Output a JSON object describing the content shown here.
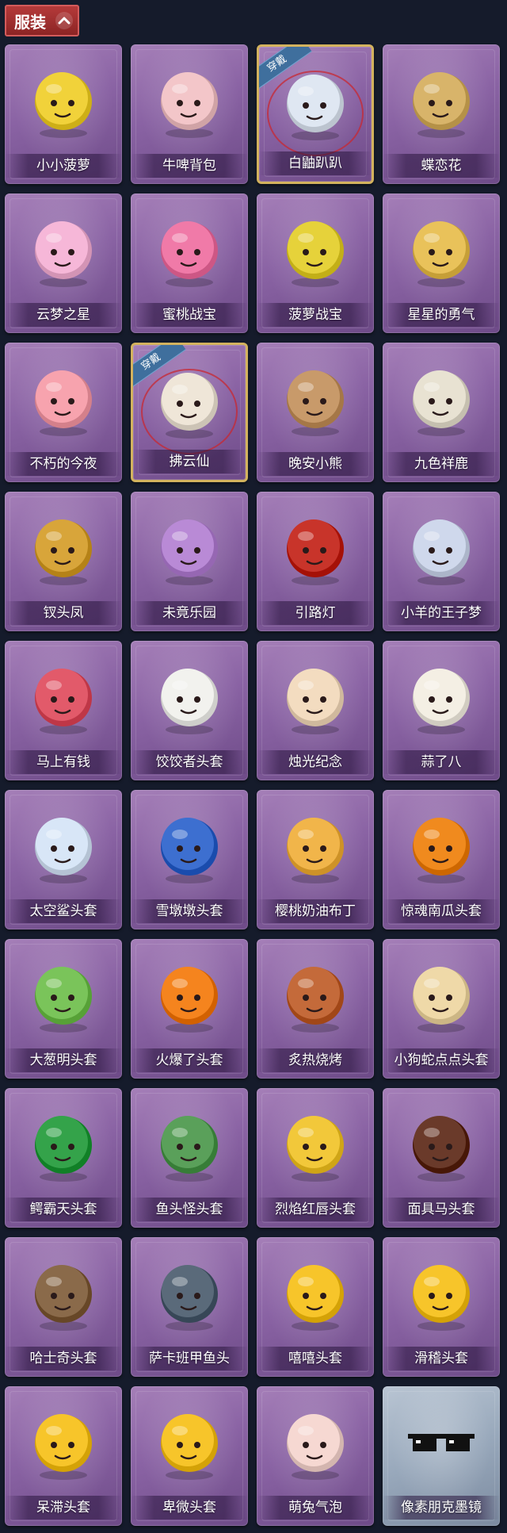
{
  "section": {
    "label": "服装"
  },
  "equipped_badge": "穿戴",
  "items": [
    {
      "name": "小小菠萝",
      "color": "#f1d23a",
      "icon": "pineapple-costume-icon"
    },
    {
      "name": "牛啤背包",
      "color": "#f3c6c9",
      "icon": "cow-beer-backpack-icon"
    },
    {
      "name": "白鼬趴趴",
      "color": "#dfe7f2",
      "icon": "white-weasel-icon",
      "equipped": true
    },
    {
      "name": "蝶恋花",
      "color": "#d8b46a",
      "icon": "butterfly-charm-icon"
    },
    {
      "name": "云梦之星",
      "color": "#f6b7d8",
      "icon": "unicorn-cloud-icon"
    },
    {
      "name": "蜜桃战宝",
      "color": "#f07aa8",
      "icon": "peach-robot-charm-icon"
    },
    {
      "name": "菠萝战宝",
      "color": "#e6d23a",
      "icon": "pineapple-robot-charm-icon"
    },
    {
      "name": "星星的勇气",
      "color": "#e9c25a",
      "icon": "star-courage-charm-icon"
    },
    {
      "name": "不朽的今夜",
      "color": "#f7a3ae",
      "icon": "fox-dessert-icon"
    },
    {
      "name": "拂云仙",
      "color": "#efe6d8",
      "icon": "cloud-fairy-charm-icon",
      "equipped": true
    },
    {
      "name": "晚安小熊",
      "color": "#c89a6a",
      "icon": "goodnight-bear-charm-icon"
    },
    {
      "name": "九色祥鹿",
      "color": "#e8e2d2",
      "icon": "nine-color-deer-icon"
    },
    {
      "name": "钗头凤",
      "color": "#d8a53a",
      "icon": "phoenix-hairpin-icon"
    },
    {
      "name": "未竟乐园",
      "color": "#b98ad6",
      "icon": "paradise-girl-charm-icon"
    },
    {
      "name": "引路灯",
      "color": "#c8342a",
      "icon": "lantern-icon"
    },
    {
      "name": "小羊的王子梦",
      "color": "#cfd8ec",
      "icon": "sheep-prince-icon"
    },
    {
      "name": "马上有钱",
      "color": "#e25a6a",
      "icon": "horse-head-icon"
    },
    {
      "name": "饺饺者头套",
      "color": "#f2f2ee",
      "icon": "dumpling-head-icon"
    },
    {
      "name": "烛光纪念",
      "color": "#f3dcc0",
      "icon": "candle-head-icon"
    },
    {
      "name": "蒜了八",
      "color": "#f4efe4",
      "icon": "garlic-head-icon"
    },
    {
      "name": "太空鲨头套",
      "color": "#d8e6f7",
      "icon": "space-shark-head-icon"
    },
    {
      "name": "雪墩墩头套",
      "color": "#3d6fd0",
      "icon": "snowman-reindeer-head-icon"
    },
    {
      "name": "樱桃奶油布丁",
      "color": "#f1b54a",
      "icon": "cherry-pudding-head-icon"
    },
    {
      "name": "惊魂南瓜头套",
      "color": "#f08a1e",
      "icon": "pumpkin-head-icon"
    },
    {
      "name": "大葱明头套",
      "color": "#7ac45a",
      "icon": "green-onion-head-icon"
    },
    {
      "name": "火爆了头套",
      "color": "#f5841e",
      "icon": "fire-head-icon"
    },
    {
      "name": "炙热烧烤",
      "color": "#c46a3a",
      "icon": "barbecue-head-icon"
    },
    {
      "name": "小狗蛇点点头套",
      "color": "#efd9a8",
      "icon": "dog-snake-head-icon"
    },
    {
      "name": "鳄霸天头套",
      "color": "#34a34a",
      "icon": "crocodile-head-icon"
    },
    {
      "name": "鱼头怪头套",
      "color": "#5aa05a",
      "icon": "fish-monster-head-icon"
    },
    {
      "name": "烈焰红唇头套",
      "color": "#f2c83a",
      "icon": "red-lips-head-icon"
    },
    {
      "name": "面具马头套",
      "color": "#6a3a2a",
      "icon": "horse-mask-head-icon"
    },
    {
      "name": "哈士奇头套",
      "color": "#8a6a4a",
      "icon": "husky-head-icon"
    },
    {
      "name": "萨卡班甲鱼头",
      "color": "#5a6a7a",
      "icon": "sacabambaspis-head-icon"
    },
    {
      "name": "嘻嘻头套",
      "color": "#f7c52a",
      "icon": "grin-emoji-head-icon"
    },
    {
      "name": "滑稽头套",
      "color": "#f7c52a",
      "icon": "funny-emoji-head-icon"
    },
    {
      "name": "呆滞头套",
      "color": "#f7c52a",
      "icon": "stunned-emoji-head-icon"
    },
    {
      "name": "卑微头套",
      "color": "#f7c52a",
      "icon": "pleading-emoji-head-icon"
    },
    {
      "name": "萌兔气泡",
      "color": "#f6d8d2",
      "icon": "bunny-bubble-icon"
    },
    {
      "name": "像素朋克墨镜",
      "color": "#111111",
      "icon": "pixel-sunglasses-icon",
      "pale": true
    }
  ]
}
